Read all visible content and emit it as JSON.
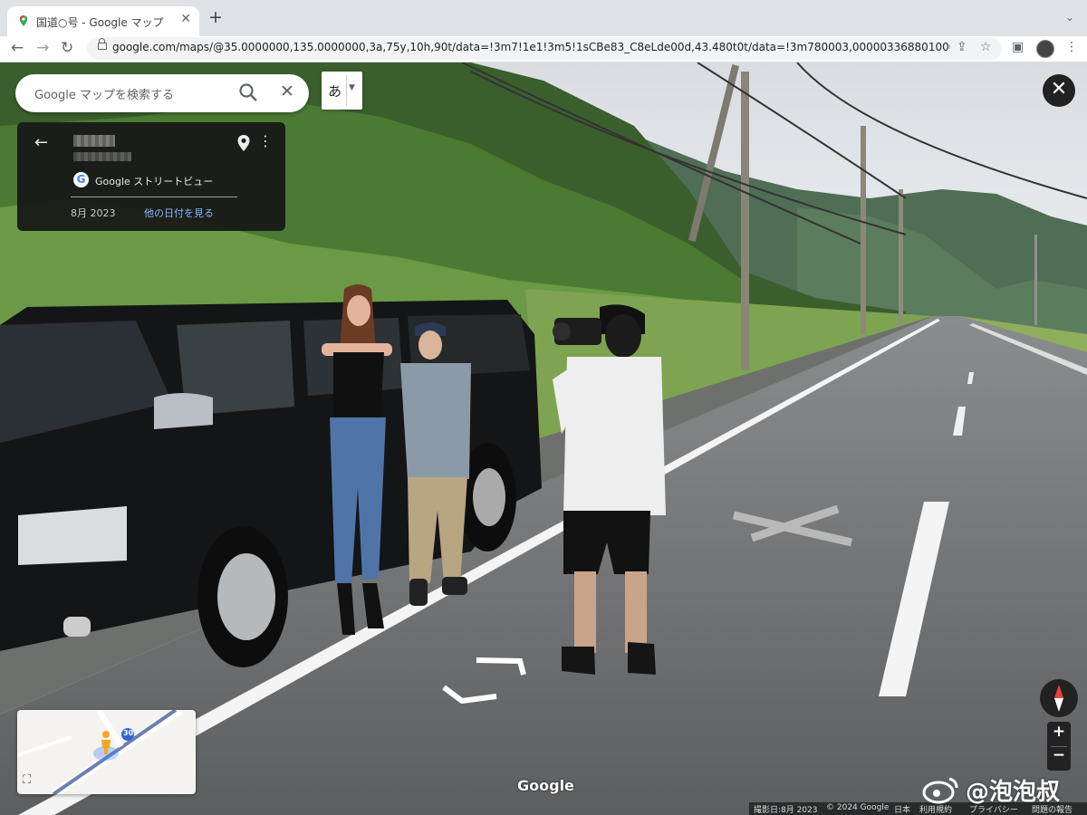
{
  "browser": {
    "tab_title": "国道○号 - Google マップ",
    "new_tab": "+",
    "url": "google.com/maps/@35.0000000,135.0000000,3a,75y,10h,90t/data=!3m7!1e1!3m5!1sCBe83_C8eLde00d,43.480t0t/data=!3m780003,000003368801000088883921361633..."
  },
  "maps": {
    "search_placeholder": "Google マップを検索する",
    "ime_label": "あ",
    "info": {
      "source": "Google ストリートビュー",
      "date": "8月 2023",
      "other_dates": "他の日付を見る"
    },
    "watermark": "Google",
    "footer": {
      "capture": "撮影日:8月 2023",
      "copyright": "© 2024 Google",
      "country": "日本",
      "terms": "利用規約",
      "privacy": "プライバシー",
      "report": "問題の報告"
    },
    "minimap_route": "30"
  },
  "overlay": {
    "weibo_handle": "@泡泡叔"
  },
  "icons": [
    "maps-pin-icon",
    "close-icon",
    "back-arrow-icon",
    "forward-arrow-icon",
    "reload-icon",
    "lock-icon",
    "share-icon",
    "star-icon",
    "sidepanel-icon",
    "kebab-menu-icon",
    "search-icon",
    "pin-icon",
    "compass-icon",
    "pegman-icon",
    "expand-icon",
    "weibo-icon"
  ],
  "colors": {
    "accent": "#8ab4f8",
    "card_bg": "#161616",
    "chrome_bg": "#dee1e6"
  }
}
